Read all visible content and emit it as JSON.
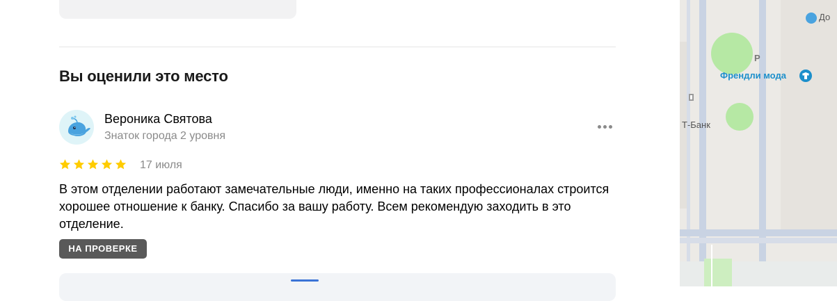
{
  "section": {
    "title": "Вы оценили это место"
  },
  "review": {
    "author_name": "Вероника Святова",
    "author_level": "Знаток города 2 уровня",
    "rating": 5,
    "rating_max": 5,
    "date": "17 июля",
    "text": "В этом отделении работают замечательные люди, именно на таких профессионалах строится хорошее отношение к банку. Спасибо за вашу работу. Всем рекомендую заходить в это отделение.",
    "status_badge": "НА ПРОВЕРКЕ"
  },
  "map": {
    "labels": {
      "shop": "Френдли мода",
      "bank": "Т-Банк",
      "partial_top": "До",
      "partial_letter": "Р"
    }
  },
  "colors": {
    "star": "#fc0",
    "badge_bg": "#595959",
    "map_shop_text": "#1c8fcb"
  }
}
